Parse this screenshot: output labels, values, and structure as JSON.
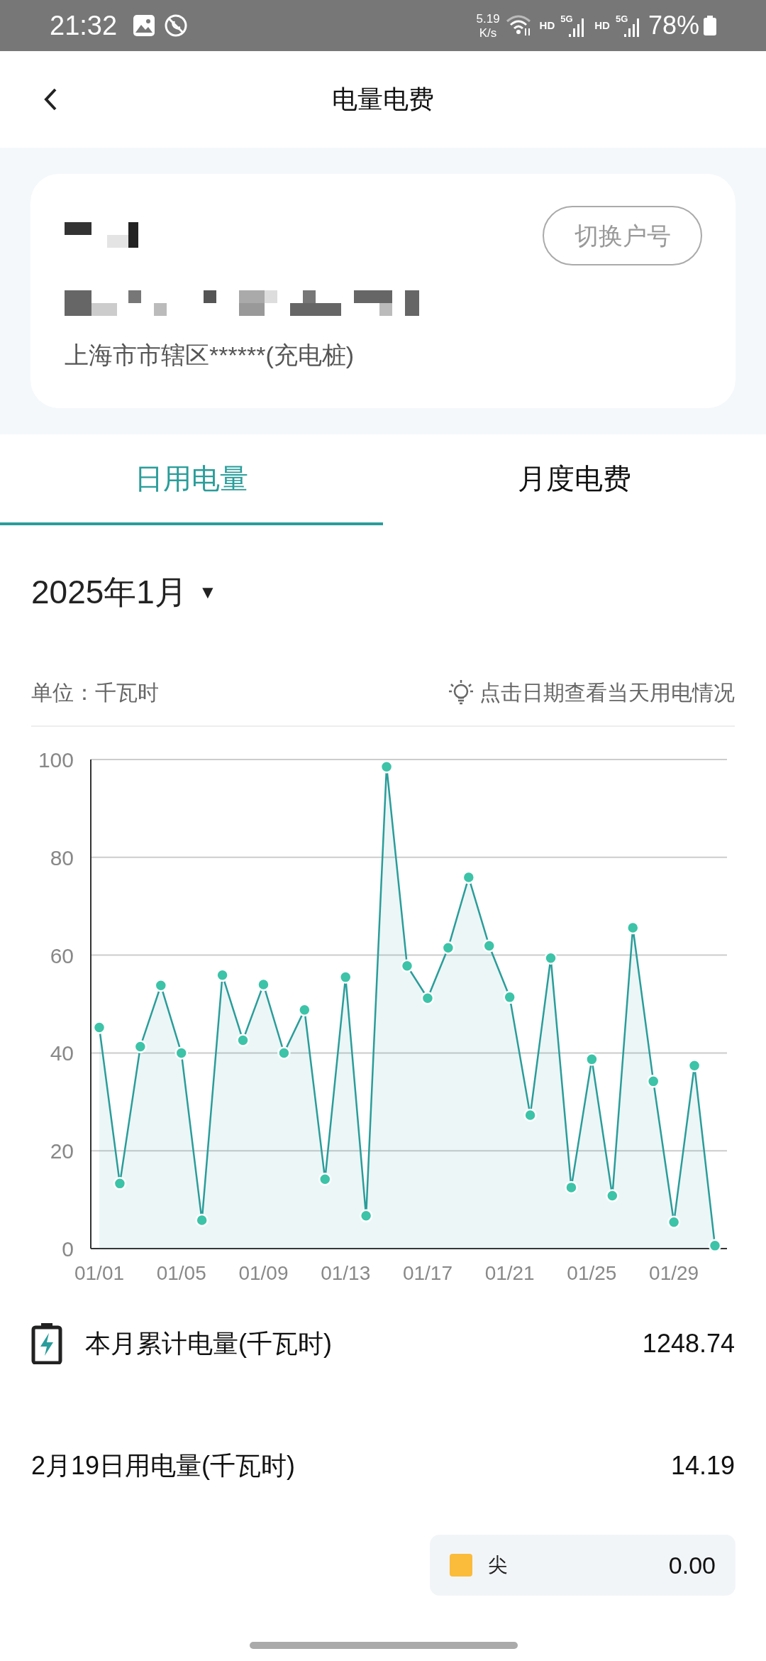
{
  "status_bar": {
    "time": "21:32",
    "speed": "5.19",
    "speed_unit": "K/s",
    "sim1_hd": "HD",
    "sim1_net": "5G",
    "sim2_hd": "HD",
    "sim2_net": "5G",
    "battery": "78%"
  },
  "header": {
    "title": "电量电费"
  },
  "account": {
    "address": "上海市市辖区******(充电桩)",
    "switch_button": "切换户号"
  },
  "tabs": [
    {
      "label": "日用电量",
      "selected": true
    },
    {
      "label": "月度电费",
      "selected": false
    }
  ],
  "month_picker": {
    "label": "2025年1月",
    "arrow": "▼"
  },
  "unit": "单位：千瓦时",
  "hint": "点击日期查看当天用电情况",
  "chart_data": {
    "type": "area",
    "color": "#2a9d9a",
    "grid": true,
    "categories": [
      "01/01",
      null,
      null,
      null,
      "01/05",
      null,
      null,
      null,
      "01/09",
      null,
      null,
      null,
      "01/13",
      null,
      null,
      null,
      "01/17",
      null,
      null,
      null,
      "01/21",
      null,
      null,
      null,
      "01/25",
      null,
      null,
      null,
      "01/29",
      null,
      null
    ],
    "values": [
      45.2,
      13.3,
      41.3,
      53.8,
      40.0,
      5.8,
      55.9,
      42.6,
      54.0,
      40.0,
      48.8,
      14.2,
      55.5,
      6.7,
      98.5,
      57.8,
      51.2,
      61.5,
      75.9,
      61.9,
      51.4,
      27.3,
      59.4,
      12.5,
      38.7,
      10.8,
      65.6,
      34.2,
      5.4,
      37.4,
      0.6
    ],
    "ylim": [
      0,
      100
    ],
    "yticks": [
      0,
      20,
      40,
      60,
      80,
      100
    ]
  },
  "summary": [
    {
      "label": "本月累计电量(千瓦时)",
      "value": "1248.74",
      "icon": true
    },
    {
      "label": "2月19日用电量(千瓦时)",
      "value": "14.19",
      "icon": false
    }
  ],
  "legend": [
    {
      "label": "尖",
      "value": "0.00",
      "color": "#fbbc3c"
    }
  ]
}
